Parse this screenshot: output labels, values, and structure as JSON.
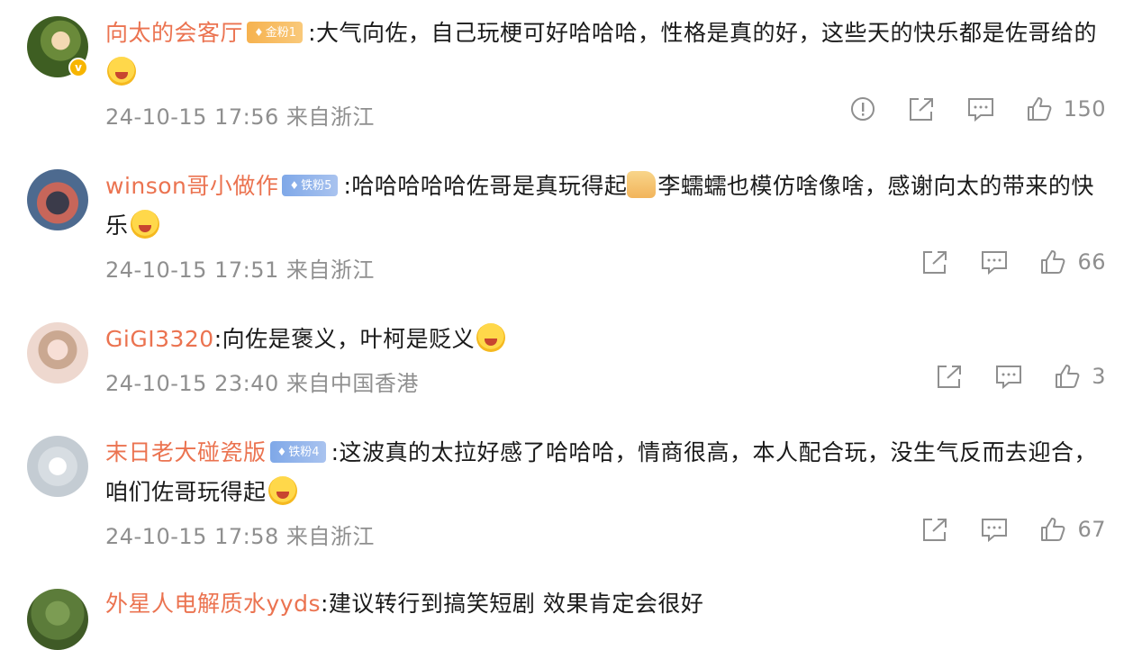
{
  "comments": [
    {
      "user": "向太的会客厅",
      "badge": "金粉1",
      "text": ":大气向佐，自己玩梗可好哈哈哈，性格是真的好，这些天的快乐都是佐哥给的",
      "time": "24-10-15 17:56 来自浙江",
      "likes": "150"
    },
    {
      "user": "winson哥小做作",
      "badge": "铁粉5",
      "text_a": ":哈哈哈哈哈佐哥是真玩得起",
      "text_b": "李蠕蠕也模仿啥像啥，感谢向太的带来的快乐",
      "time": "24-10-15 17:51 来自浙江",
      "likes": "66"
    },
    {
      "user": "GiGI3320",
      "text": ":向佐是褒义，叶柯是贬义",
      "time": "24-10-15 23:40 来自中国香港",
      "likes": "3"
    },
    {
      "user": "末日老大碰瓷版",
      "badge": "铁粉4",
      "text": ":这波真的太拉好感了哈哈哈，情商很高，本人配合玩，没生气反而去迎合，咱们佐哥玩得起",
      "time": "24-10-15 17:58 来自浙江",
      "likes": "67"
    },
    {
      "user": "外星人电解质水yyds",
      "text": ":建议转行到搞笑短剧 效果肯定会很好"
    }
  ],
  "icons": [
    "report-icon",
    "share-icon",
    "comment-icon",
    "like-icon"
  ],
  "colors": {
    "username": "#eb7350",
    "meta": "#8f8f8f",
    "gold_badge": "#f6b24f",
    "iron_badge": "#7fa8e8"
  }
}
